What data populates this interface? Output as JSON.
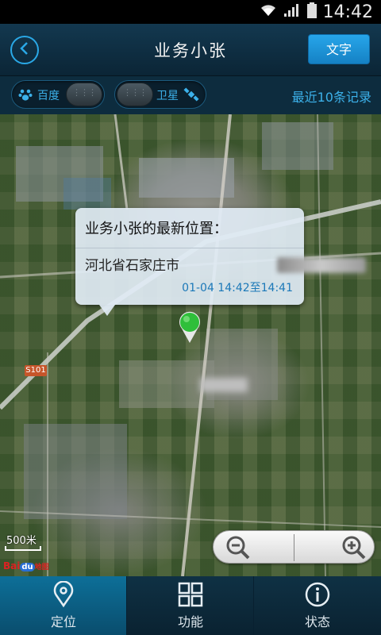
{
  "status_bar": {
    "time": "14:42"
  },
  "header": {
    "title": "业务小张",
    "text_button": "文字"
  },
  "toggles": {
    "baidu_label": "百度",
    "satellite_label": "卫星",
    "records_link": "最近10条记录"
  },
  "map": {
    "bubble": {
      "title": "业务小张的最新位置：",
      "address": "河北省石家庄市",
      "time_range": "01-04 14:42至14:41"
    },
    "road_sign": "S101",
    "scale": "500米",
    "logo": {
      "left": "Bai",
      "du": "du",
      "right": "地图"
    }
  },
  "bottom_nav": [
    {
      "label": "定位",
      "icon": "location-pin-icon",
      "active": true
    },
    {
      "label": "功能",
      "icon": "grid-icon",
      "active": false
    },
    {
      "label": "状态",
      "icon": "info-icon",
      "active": false
    }
  ],
  "colors": {
    "accent": "#2aa8e6",
    "header_bg": "#13384f",
    "nav_active": "#0d6f98",
    "pin": "#2fbf3a"
  }
}
